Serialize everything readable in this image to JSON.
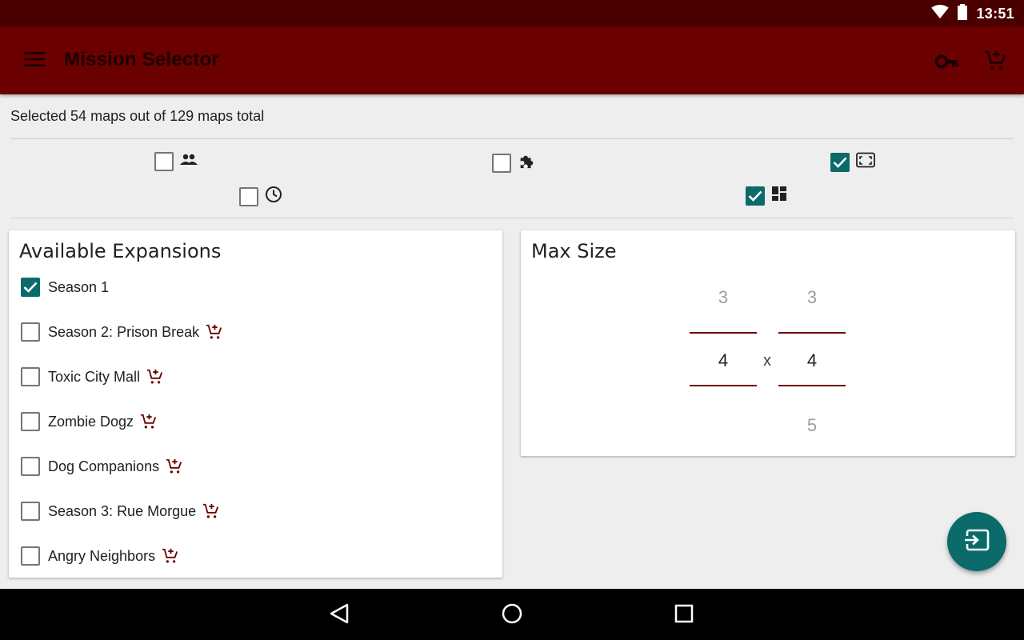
{
  "status_bar": {
    "time": "13:51",
    "icons": [
      "wifi-icon",
      "battery-icon"
    ]
  },
  "app_bar": {
    "title": "Mission Selector",
    "icons": [
      "menu-icon",
      "key-icon",
      "cart-add-icon"
    ]
  },
  "summary": {
    "text": "Selected 54 maps out of 129 maps total"
  },
  "filters": [
    {
      "icon": "people-icon",
      "checked": false
    },
    {
      "icon": "puzzle-icon",
      "checked": false
    },
    {
      "icon": "tile-size-icon",
      "checked": true
    },
    {
      "icon": "clock-icon",
      "checked": false
    },
    {
      "icon": "dashboard-icon",
      "checked": true
    }
  ],
  "expansions": {
    "title": "Available Expansions",
    "items": [
      {
        "label": "Season 1",
        "checked": true,
        "purchasable": false
      },
      {
        "label": "Season 2: Prison Break",
        "checked": false,
        "purchasable": true
      },
      {
        "label": "Toxic City Mall",
        "checked": false,
        "purchasable": true
      },
      {
        "label": "Zombie Dogz",
        "checked": false,
        "purchasable": true
      },
      {
        "label": "Dog Companions",
        "checked": false,
        "purchasable": true
      },
      {
        "label": "Season 3: Rue Morgue",
        "checked": false,
        "purchasable": true
      },
      {
        "label": "Angry Neighbors",
        "checked": false,
        "purchasable": true
      }
    ]
  },
  "max_size": {
    "title": "Max Size",
    "separator": "x",
    "width": {
      "prev": "3",
      "current": "4",
      "next": ""
    },
    "height": {
      "prev": "3",
      "current": "4",
      "next": "5"
    }
  },
  "colors": {
    "primary": "#6a0000",
    "primary_dark": "#4a0000",
    "accent": "#0b6b6b"
  },
  "fab": {
    "icon": "input-icon"
  },
  "nav": {
    "icons": [
      "back-icon",
      "home-icon",
      "recents-icon"
    ]
  }
}
